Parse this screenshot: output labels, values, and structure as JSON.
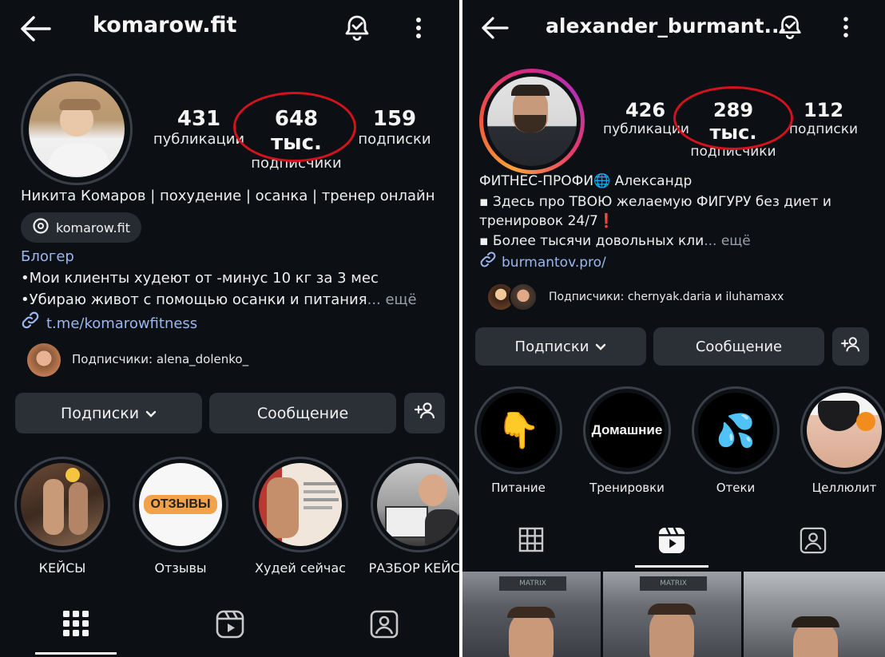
{
  "left": {
    "header": {
      "title": "komarow.fit"
    },
    "stats": [
      {
        "value": "431",
        "label": "публикации"
      },
      {
        "value": "648 тыс.",
        "label": "подписчики"
      },
      {
        "value": "159",
        "label": "подписки"
      }
    ],
    "name_line": "Никита Комаров | похудение | осанка | тренер онлайн",
    "threads_chip": "komarow.fit",
    "category": "Блогер",
    "bio_lines": [
      "•Мои клиенты худеют от -минус 10 кг за 3 мес",
      "•Убираю живот с помощью осанки и питания"
    ],
    "more": "... ещё",
    "link": "t.me/komarowfitness",
    "followed_by": "Подписчики: alena_dolenko_",
    "buttons": {
      "following": "Подписки",
      "message": "Сообщение"
    },
    "highlights": [
      {
        "label": "КЕЙСЫ"
      },
      {
        "label": "Отзывы",
        "cover_text": "ОТЗЫВЫ"
      },
      {
        "label": "Худей сейчас"
      },
      {
        "label": "РАЗБОР КЕЙСА"
      }
    ],
    "active_tab": "grid"
  },
  "right": {
    "header": {
      "title": "alexander_burmant..."
    },
    "stats": [
      {
        "value": "426",
        "label": "публикации"
      },
      {
        "value": "289 тыс.",
        "label": "подписчики"
      },
      {
        "value": "112",
        "label": "подписки"
      }
    ],
    "name_line": "ФИТНЕС-ПРОФИ🌐 Александр",
    "bio_lines": [
      "▪ Здесь про ТВОЮ желаемую ФИГУРУ без диет и",
      "тренировок 24/7❗",
      "▪ Более тысячи довольных кли"
    ],
    "more": "... ещё",
    "link": "burmantov.pro/",
    "followed_by": "Подписчики: chernyak.daria и iluhamaxx",
    "buttons": {
      "following": "Подписки",
      "message": "Сообщение"
    },
    "highlights": [
      {
        "label": "Питание",
        "cover_text": "👇"
      },
      {
        "label": "Тренировки",
        "cover_text": "Домашние"
      },
      {
        "label": "Отеки",
        "cover_text": "💦"
      },
      {
        "label": "Целлюлит"
      }
    ],
    "photo_labels": [
      "MATRIX",
      "MATRIX"
    ],
    "active_tab": "reels"
  },
  "colors": {
    "background": "#0c0f14",
    "button": "#2b2f36",
    "link": "#9ab7ee",
    "annotation": "#d2121c"
  }
}
